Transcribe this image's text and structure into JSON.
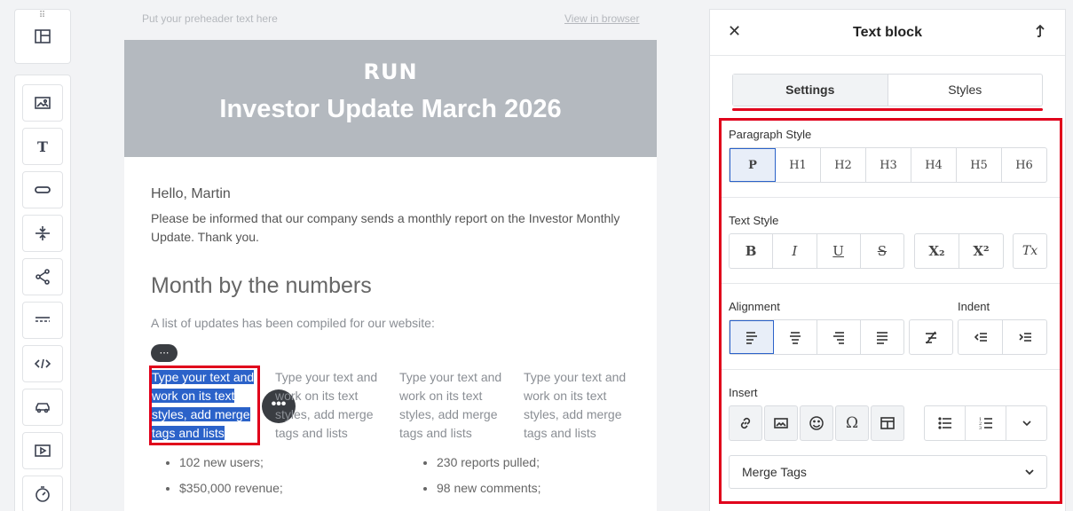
{
  "canvas": {
    "preheader": "Put your preheader text here",
    "view_in_browser": "View in browser"
  },
  "email": {
    "brand": "RUN",
    "title": "Investor Update March 2026",
    "greeting": "Hello, Martin",
    "intro": "Please be informed that our company sends a monthly report on the Investor Monthly Update. Thank you.",
    "section_title": "Month by the numbers",
    "section_sub": "A list of updates has been compiled for our website:",
    "columns": [
      "Type your text and work on its text styles, add merge tags and lists",
      "Type your text and work on its text styles, add merge tags and lists",
      "Type your text and work on its text styles, add merge tags and lists",
      "Type your text and work on its text styles, add merge tags and lists"
    ],
    "bullets_left": [
      "102 new users;",
      "$350,000 revenue;"
    ],
    "bullets_right": [
      "230 reports pulled;",
      "98 new comments;"
    ]
  },
  "panel": {
    "title": "Text block",
    "tabs": [
      "Settings",
      "Styles"
    ],
    "paragraph_style_label": "Paragraph Style",
    "paragraph_styles": [
      "P",
      "H1",
      "H2",
      "H3",
      "H4",
      "H5",
      "H6"
    ],
    "text_style_label": "Text Style",
    "text_styles": [
      "B",
      "I",
      "U",
      "S"
    ],
    "script_styles": [
      "X₂",
      "X²"
    ],
    "clear_format": "Tx",
    "alignment_label": "Alignment",
    "indent_label": "Indent",
    "insert_label": "Insert",
    "merge_tags": "Merge Tags"
  },
  "colors": {
    "accent": "#e0001b",
    "selection": "#2b62c9",
    "header_bg": "#b4b9bf"
  }
}
